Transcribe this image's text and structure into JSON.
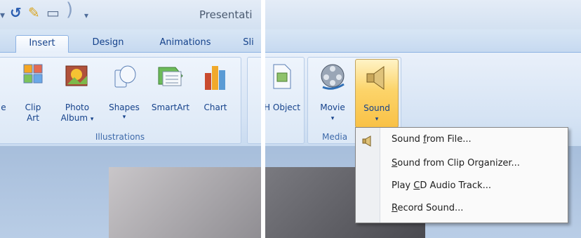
{
  "title_bar": {
    "title": "Presentati"
  },
  "tabs": [
    {
      "label": "Insert",
      "active": true
    },
    {
      "label": "Design",
      "active": false
    },
    {
      "label": "Animations",
      "active": false
    },
    {
      "label": "Sli",
      "active": false
    }
  ],
  "illustrations": {
    "clip_art_line1": "Clip",
    "clip_art_line2": "Art",
    "photo_album_line1": "Photo",
    "photo_album_line2": "Album",
    "shapes": "Shapes",
    "smartart": "SmartArt",
    "chart": "Chart",
    "group_label": "Illustrations",
    "edge_letter": "e"
  },
  "right_ribbon": {
    "hyperlink_fragment": "H",
    "object_label": "Object",
    "movie_label": "Movie",
    "sound_label": "Sound",
    "media_group_label": "Media"
  },
  "sound_menu": {
    "items": [
      {
        "pre": "Sound ",
        "key": "f",
        "post": "rom File..."
      },
      {
        "pre": "",
        "key": "S",
        "post": "ound from Clip Organizer..."
      },
      {
        "pre": "Play ",
        "key": "C",
        "post": "D Audio Track..."
      },
      {
        "pre": "",
        "key": "R",
        "post": "ecord Sound..."
      }
    ]
  },
  "colors": {
    "ribbon_text": "#15428b",
    "sound_highlight": "#fbd86d",
    "menu_bg": "#fafafa"
  }
}
